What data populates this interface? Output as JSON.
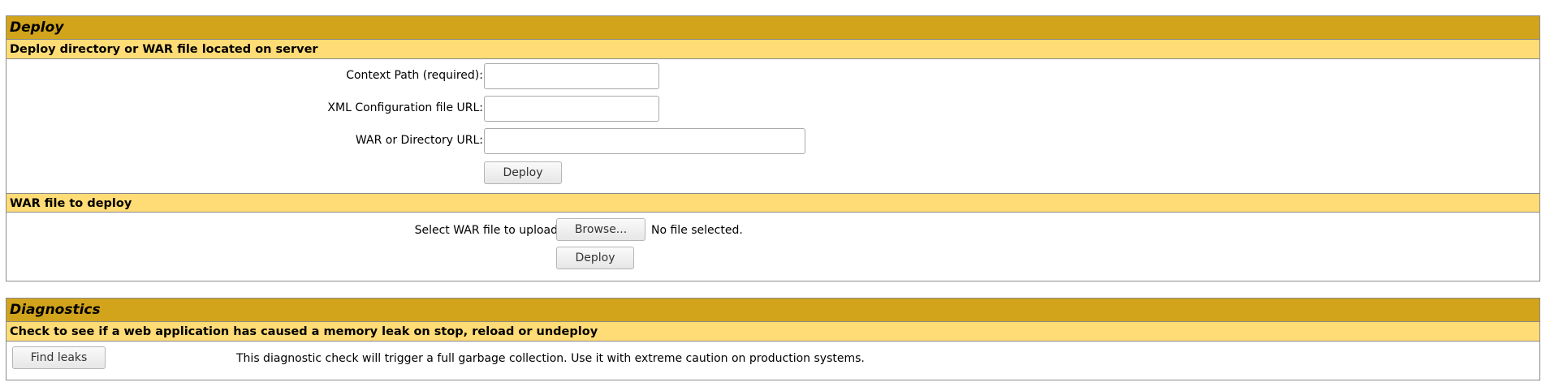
{
  "deploy": {
    "title": "Deploy",
    "server_section": {
      "heading": "Deploy directory or WAR file located on server",
      "context_path_label": "Context Path (required):",
      "context_path_value": "",
      "xml_config_label": "XML Configuration file URL:",
      "xml_config_value": "",
      "war_dir_label": "WAR or Directory URL:",
      "war_dir_value": "",
      "deploy_button": "Deploy"
    },
    "upload_section": {
      "heading": "WAR file to deploy",
      "select_label": "Select WAR file to upload",
      "browse_button": "Browse...",
      "file_status": "No file selected.",
      "deploy_button": "Deploy"
    }
  },
  "diagnostics": {
    "title": "Diagnostics",
    "heading": "Check to see if a web application has caused a memory leak on stop, reload or undeploy",
    "find_leaks_button": "Find leaks",
    "description": "This diagnostic check will trigger a full garbage collection. Use it with extreme caution on production systems."
  },
  "colors": {
    "title_bar": "#d2a41c",
    "sub_bar": "#ffdc75",
    "border": "#8a8a8a"
  }
}
